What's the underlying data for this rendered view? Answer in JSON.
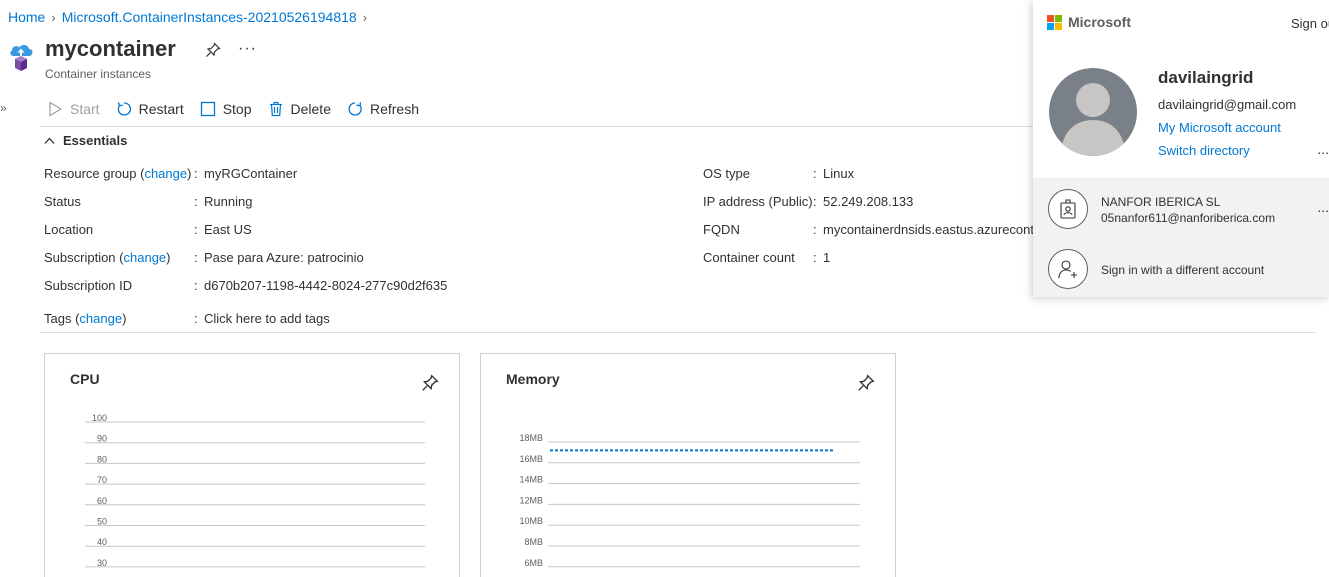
{
  "breadcrumb": {
    "home": "Home",
    "deployment": "Microsoft.ContainerInstances-20210526194818"
  },
  "header": {
    "title": "mycontainer",
    "subtitle": "Container instances",
    "more": "···",
    "expand": "»"
  },
  "toolbar": {
    "start": "Start",
    "restart": "Restart",
    "stop": "Stop",
    "delete": "Delete",
    "refresh": "Refresh"
  },
  "essentials": {
    "header": "Essentials",
    "left": {
      "resource_group": {
        "label": "Resource group",
        "change": "change",
        "value": "myRGContainer"
      },
      "status": {
        "label": "Status",
        "value": "Running"
      },
      "location": {
        "label": "Location",
        "value": "East US"
      },
      "subscription": {
        "label": "Subscription",
        "change": "change",
        "value": "Pase para Azure: patrocinio"
      },
      "subscription_id": {
        "label": "Subscription ID",
        "value": "d670b207-1198-4442-8024-277c90d2f635"
      },
      "tags": {
        "label": "Tags",
        "change": "change",
        "value": "Click here to add tags"
      }
    },
    "right": {
      "os_type": {
        "label": "OS type",
        "value": "Linux"
      },
      "ip_address": {
        "label": "IP address (Public)",
        "value": "52.249.208.133"
      },
      "fqdn": {
        "label": "FQDN",
        "value": "mycontainerdnsids.eastus.azureconta"
      },
      "container_count": {
        "label": "Container count",
        "value": "1"
      }
    }
  },
  "tiles": {
    "cpu": {
      "title": "CPU",
      "ticks": [
        "100",
        "90",
        "80",
        "70",
        "60",
        "50",
        "40",
        "30"
      ]
    },
    "memory": {
      "title": "Memory",
      "ticks": [
        "18MB",
        "16MB",
        "14MB",
        "12MB",
        "10MB",
        "8MB",
        "6MB"
      ]
    }
  },
  "chart_data": [
    {
      "type": "line",
      "title": "CPU",
      "yticks": [
        100,
        90,
        80,
        70,
        60,
        50,
        40,
        30
      ],
      "series": []
    },
    {
      "type": "line",
      "title": "Memory",
      "yticks_mb": [
        18,
        16,
        14,
        12,
        10,
        8,
        6
      ],
      "series": [
        {
          "style": "dashed",
          "color": "#0078d4",
          "values_mb": [
            17.2,
            17.2
          ]
        }
      ]
    }
  ],
  "account": {
    "brand": "Microsoft",
    "sign_out": "Sign out",
    "user_name": "davilaingrid",
    "user_email": "davilaingrid@gmail.com",
    "my_account": "My Microsoft account",
    "switch_directory": "Switch directory",
    "dots": "...",
    "tenant_name": "NANFOR IBERICA SL",
    "tenant_email": "05nanfor611@nanforiberica.com",
    "different_account": "Sign in with a different account"
  },
  "colors": {
    "link": "#0078d4",
    "ms_red": "#f25022",
    "ms_green": "#7fba00",
    "ms_blue": "#00a4ef",
    "ms_yellow": "#ffb900"
  }
}
